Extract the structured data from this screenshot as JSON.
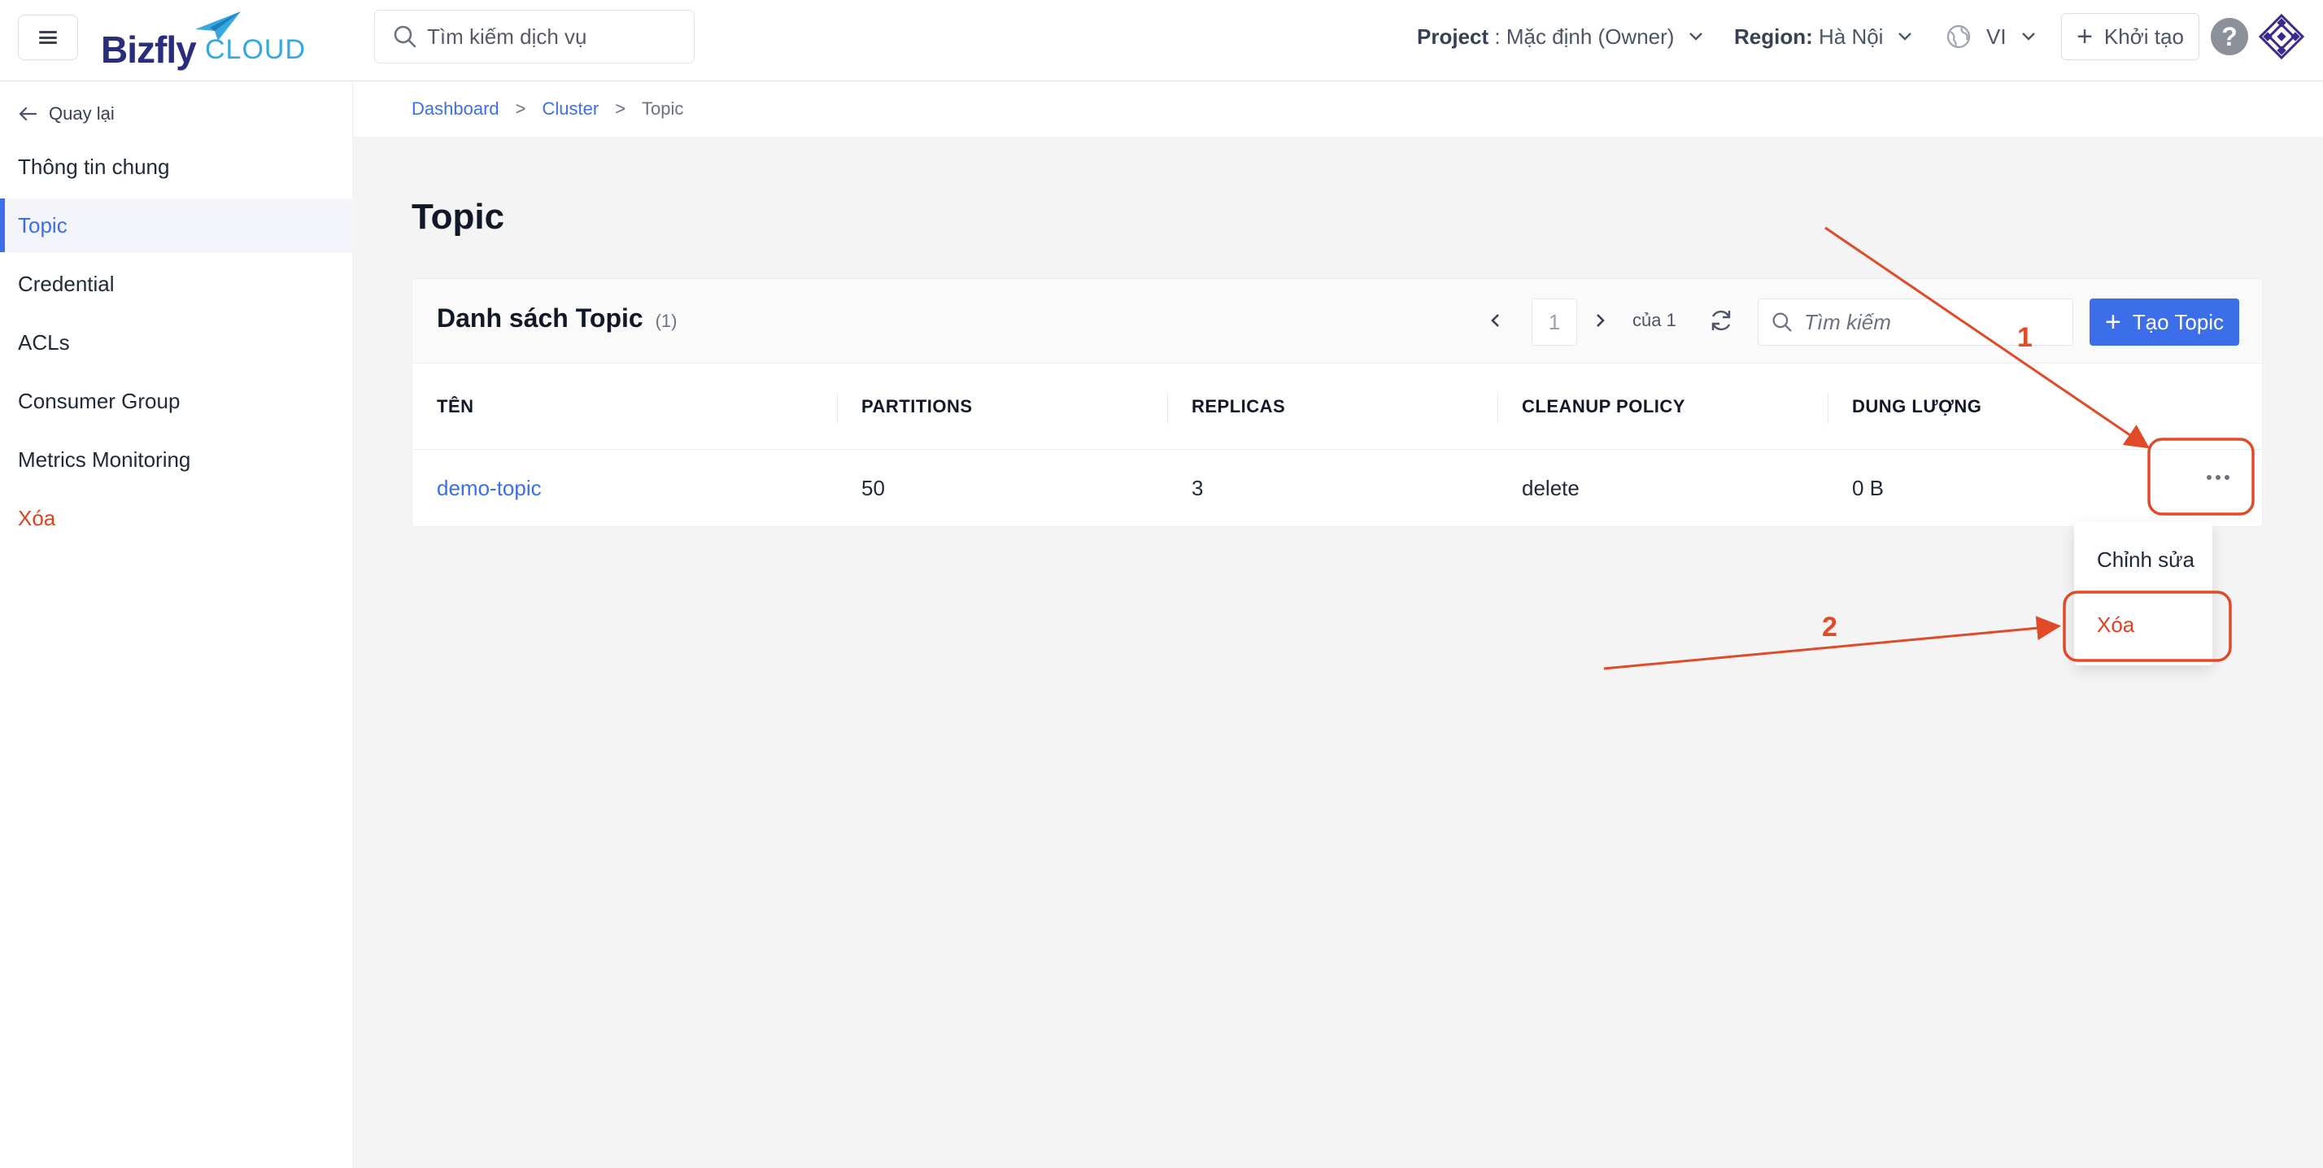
{
  "header": {
    "logo_main": "Bizfly",
    "logo_sub": "CLOUD",
    "search_placeholder": "Tìm kiếm dịch vụ",
    "project_label": "Project",
    "project_value": " : Mặc định (Owner)",
    "region_label": "Region:",
    "region_value": " Hà Nội",
    "language": "VI",
    "create_label": "Khởi tạo",
    "help_symbol": "?"
  },
  "sidebar": {
    "back_label": "Quay lại",
    "items": [
      {
        "label": "Thông tin chung"
      },
      {
        "label": "Topic"
      },
      {
        "label": "Credential"
      },
      {
        "label": "ACLs"
      },
      {
        "label": "Consumer Group"
      },
      {
        "label": "Metrics Monitoring"
      },
      {
        "label": "Xóa"
      }
    ]
  },
  "breadcrumb": {
    "items": [
      "Dashboard",
      "Cluster",
      "Topic"
    ],
    "separator": ">"
  },
  "page": {
    "title": "Topic"
  },
  "card": {
    "title": "Danh sách Topic",
    "count": "(1)",
    "pager": {
      "current": "1",
      "of_label": "của 1"
    },
    "search_placeholder": "Tìm kiếm",
    "create_label": "Tạo Topic"
  },
  "table": {
    "columns": [
      "TÊN",
      "PARTITIONS",
      "REPLICAS",
      "CLEANUP POLICY",
      "DUNG LƯỢNG"
    ],
    "rows": [
      [
        "demo-topic",
        "50",
        "3",
        "delete",
        "0 B"
      ]
    ]
  },
  "row_menu": {
    "items": [
      {
        "label": "Chỉnh sửa"
      },
      {
        "label": "Xóa"
      }
    ]
  },
  "annotations": {
    "step1": "1",
    "step2": "2",
    "color": "#e04a28"
  },
  "colors": {
    "primary": "#3b6ee8",
    "danger": "#e2401c",
    "background": "#f4f4f5"
  }
}
